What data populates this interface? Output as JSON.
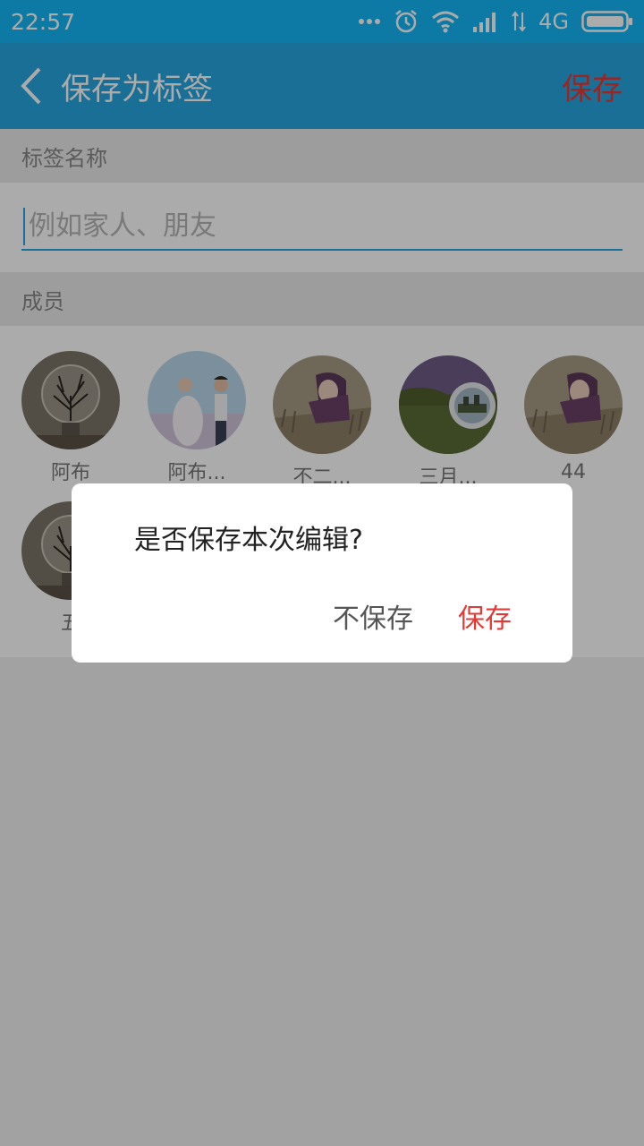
{
  "status_bar": {
    "time": "22:57",
    "network": "4G",
    "icons": [
      "more-dots-icon",
      "alarm-icon",
      "wifi-icon",
      "signal-icon",
      "data-arrows-icon",
      "battery-icon"
    ]
  },
  "app_bar": {
    "back_icon": "back-chevron-icon",
    "title": "保存为标签",
    "save_label": "保存"
  },
  "tag_name": {
    "section_label": "标签名称",
    "placeholder": "例如家人、朋友",
    "value": ""
  },
  "members": {
    "section_label": "成员",
    "items": [
      {
        "name": "阿布",
        "avatar": "tree-bulb"
      },
      {
        "name": "阿布...",
        "avatar": "wedding-couple"
      },
      {
        "name": "不二...",
        "avatar": "girl-field"
      },
      {
        "name": "三月...",
        "avatar": "purple-landscape"
      },
      {
        "name": "44",
        "avatar": "girl-field"
      },
      {
        "name": "五",
        "avatar": "tree-bulb"
      }
    ]
  },
  "dialog": {
    "message": "是否保存本次编辑?",
    "cancel_label": "不保存",
    "confirm_label": "保存"
  },
  "colors": {
    "status_bar": "#12b7f5",
    "app_bar": "#27a6e0",
    "accent_red": "#e53935",
    "scrim": "rgba(0,0,0,0.33)"
  }
}
